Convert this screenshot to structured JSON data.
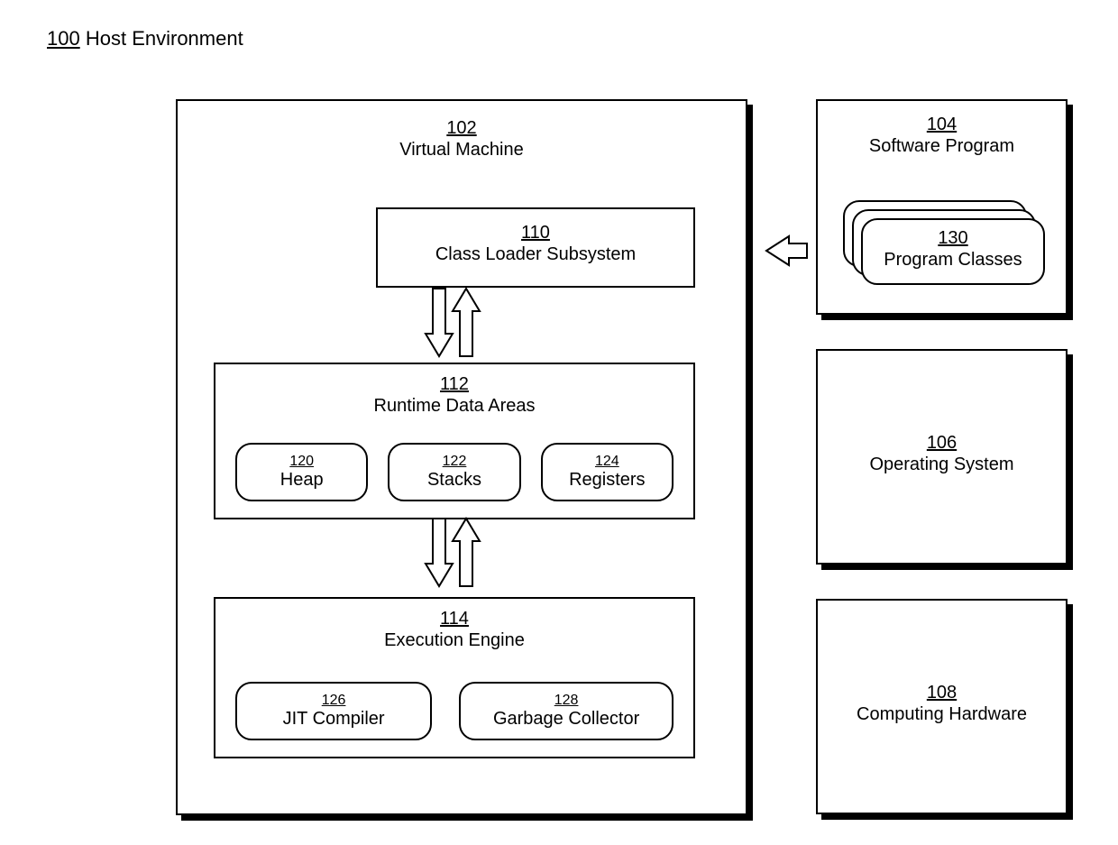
{
  "header": {
    "ref": "100",
    "label": "Host Environment"
  },
  "vm": {
    "ref": "102",
    "label": "Virtual Machine",
    "classLoader": {
      "ref": "110",
      "label": "Class Loader Subsystem"
    },
    "runtime": {
      "ref": "112",
      "label": "Runtime Data Areas",
      "heap": {
        "ref": "120",
        "label": "Heap"
      },
      "stacks": {
        "ref": "122",
        "label": "Stacks"
      },
      "regs": {
        "ref": "124",
        "label": "Registers"
      }
    },
    "exec": {
      "ref": "114",
      "label": "Execution Engine",
      "jit": {
        "ref": "126",
        "label": "JIT Compiler"
      },
      "gc": {
        "ref": "128",
        "label": "Garbage Collector"
      }
    }
  },
  "sw": {
    "ref": "104",
    "label": "Software Program",
    "programClasses": {
      "ref": "130",
      "label": "Program Classes"
    }
  },
  "os": {
    "ref": "106",
    "label": "Operating System"
  },
  "hw": {
    "ref": "108",
    "label": "Computing Hardware"
  }
}
